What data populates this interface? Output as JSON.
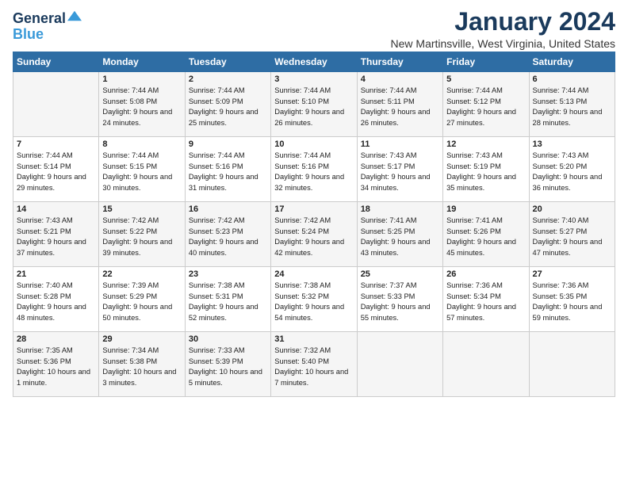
{
  "header": {
    "logo_line1": "General",
    "logo_line2": "Blue",
    "month": "January 2024",
    "location": "New Martinsville, West Virginia, United States"
  },
  "days_of_week": [
    "Sunday",
    "Monday",
    "Tuesday",
    "Wednesday",
    "Thursday",
    "Friday",
    "Saturday"
  ],
  "weeks": [
    [
      {
        "day": "",
        "sunrise": "",
        "sunset": "",
        "daylight": ""
      },
      {
        "day": "1",
        "sunrise": "Sunrise: 7:44 AM",
        "sunset": "Sunset: 5:08 PM",
        "daylight": "Daylight: 9 hours and 24 minutes."
      },
      {
        "day": "2",
        "sunrise": "Sunrise: 7:44 AM",
        "sunset": "Sunset: 5:09 PM",
        "daylight": "Daylight: 9 hours and 25 minutes."
      },
      {
        "day": "3",
        "sunrise": "Sunrise: 7:44 AM",
        "sunset": "Sunset: 5:10 PM",
        "daylight": "Daylight: 9 hours and 26 minutes."
      },
      {
        "day": "4",
        "sunrise": "Sunrise: 7:44 AM",
        "sunset": "Sunset: 5:11 PM",
        "daylight": "Daylight: 9 hours and 26 minutes."
      },
      {
        "day": "5",
        "sunrise": "Sunrise: 7:44 AM",
        "sunset": "Sunset: 5:12 PM",
        "daylight": "Daylight: 9 hours and 27 minutes."
      },
      {
        "day": "6",
        "sunrise": "Sunrise: 7:44 AM",
        "sunset": "Sunset: 5:13 PM",
        "daylight": "Daylight: 9 hours and 28 minutes."
      }
    ],
    [
      {
        "day": "7",
        "sunrise": "Sunrise: 7:44 AM",
        "sunset": "Sunset: 5:14 PM",
        "daylight": "Daylight: 9 hours and 29 minutes."
      },
      {
        "day": "8",
        "sunrise": "Sunrise: 7:44 AM",
        "sunset": "Sunset: 5:15 PM",
        "daylight": "Daylight: 9 hours and 30 minutes."
      },
      {
        "day": "9",
        "sunrise": "Sunrise: 7:44 AM",
        "sunset": "Sunset: 5:16 PM",
        "daylight": "Daylight: 9 hours and 31 minutes."
      },
      {
        "day": "10",
        "sunrise": "Sunrise: 7:44 AM",
        "sunset": "Sunset: 5:16 PM",
        "daylight": "Daylight: 9 hours and 32 minutes."
      },
      {
        "day": "11",
        "sunrise": "Sunrise: 7:43 AM",
        "sunset": "Sunset: 5:17 PM",
        "daylight": "Daylight: 9 hours and 34 minutes."
      },
      {
        "day": "12",
        "sunrise": "Sunrise: 7:43 AM",
        "sunset": "Sunset: 5:19 PM",
        "daylight": "Daylight: 9 hours and 35 minutes."
      },
      {
        "day": "13",
        "sunrise": "Sunrise: 7:43 AM",
        "sunset": "Sunset: 5:20 PM",
        "daylight": "Daylight: 9 hours and 36 minutes."
      }
    ],
    [
      {
        "day": "14",
        "sunrise": "Sunrise: 7:43 AM",
        "sunset": "Sunset: 5:21 PM",
        "daylight": "Daylight: 9 hours and 37 minutes."
      },
      {
        "day": "15",
        "sunrise": "Sunrise: 7:42 AM",
        "sunset": "Sunset: 5:22 PM",
        "daylight": "Daylight: 9 hours and 39 minutes."
      },
      {
        "day": "16",
        "sunrise": "Sunrise: 7:42 AM",
        "sunset": "Sunset: 5:23 PM",
        "daylight": "Daylight: 9 hours and 40 minutes."
      },
      {
        "day": "17",
        "sunrise": "Sunrise: 7:42 AM",
        "sunset": "Sunset: 5:24 PM",
        "daylight": "Daylight: 9 hours and 42 minutes."
      },
      {
        "day": "18",
        "sunrise": "Sunrise: 7:41 AM",
        "sunset": "Sunset: 5:25 PM",
        "daylight": "Daylight: 9 hours and 43 minutes."
      },
      {
        "day": "19",
        "sunrise": "Sunrise: 7:41 AM",
        "sunset": "Sunset: 5:26 PM",
        "daylight": "Daylight: 9 hours and 45 minutes."
      },
      {
        "day": "20",
        "sunrise": "Sunrise: 7:40 AM",
        "sunset": "Sunset: 5:27 PM",
        "daylight": "Daylight: 9 hours and 47 minutes."
      }
    ],
    [
      {
        "day": "21",
        "sunrise": "Sunrise: 7:40 AM",
        "sunset": "Sunset: 5:28 PM",
        "daylight": "Daylight: 9 hours and 48 minutes."
      },
      {
        "day": "22",
        "sunrise": "Sunrise: 7:39 AM",
        "sunset": "Sunset: 5:29 PM",
        "daylight": "Daylight: 9 hours and 50 minutes."
      },
      {
        "day": "23",
        "sunrise": "Sunrise: 7:38 AM",
        "sunset": "Sunset: 5:31 PM",
        "daylight": "Daylight: 9 hours and 52 minutes."
      },
      {
        "day": "24",
        "sunrise": "Sunrise: 7:38 AM",
        "sunset": "Sunset: 5:32 PM",
        "daylight": "Daylight: 9 hours and 54 minutes."
      },
      {
        "day": "25",
        "sunrise": "Sunrise: 7:37 AM",
        "sunset": "Sunset: 5:33 PM",
        "daylight": "Daylight: 9 hours and 55 minutes."
      },
      {
        "day": "26",
        "sunrise": "Sunrise: 7:36 AM",
        "sunset": "Sunset: 5:34 PM",
        "daylight": "Daylight: 9 hours and 57 minutes."
      },
      {
        "day": "27",
        "sunrise": "Sunrise: 7:36 AM",
        "sunset": "Sunset: 5:35 PM",
        "daylight": "Daylight: 9 hours and 59 minutes."
      }
    ],
    [
      {
        "day": "28",
        "sunrise": "Sunrise: 7:35 AM",
        "sunset": "Sunset: 5:36 PM",
        "daylight": "Daylight: 10 hours and 1 minute."
      },
      {
        "day": "29",
        "sunrise": "Sunrise: 7:34 AM",
        "sunset": "Sunset: 5:38 PM",
        "daylight": "Daylight: 10 hours and 3 minutes."
      },
      {
        "day": "30",
        "sunrise": "Sunrise: 7:33 AM",
        "sunset": "Sunset: 5:39 PM",
        "daylight": "Daylight: 10 hours and 5 minutes."
      },
      {
        "day": "31",
        "sunrise": "Sunrise: 7:32 AM",
        "sunset": "Sunset: 5:40 PM",
        "daylight": "Daylight: 10 hours and 7 minutes."
      },
      {
        "day": "",
        "sunrise": "",
        "sunset": "",
        "daylight": ""
      },
      {
        "day": "",
        "sunrise": "",
        "sunset": "",
        "daylight": ""
      },
      {
        "day": "",
        "sunrise": "",
        "sunset": "",
        "daylight": ""
      }
    ]
  ]
}
